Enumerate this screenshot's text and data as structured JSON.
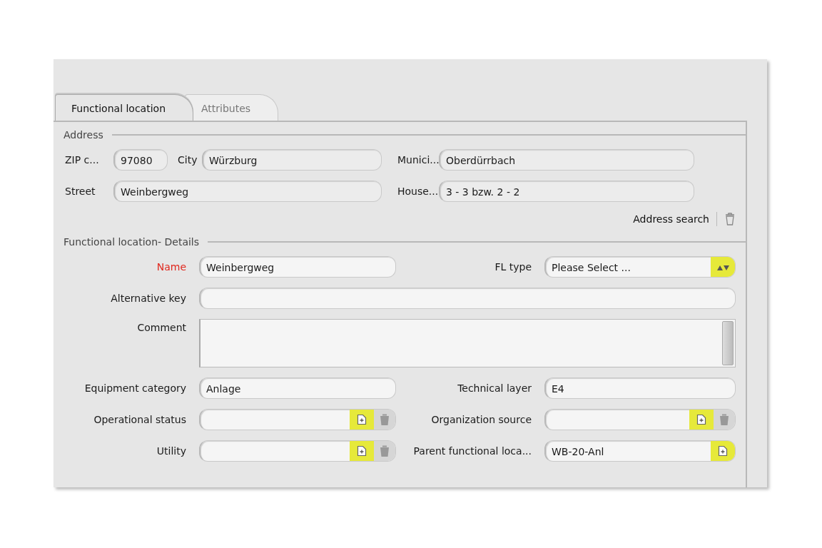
{
  "tabs": [
    {
      "label": "Functional location",
      "selected": true
    },
    {
      "label": "Attributes",
      "selected": false
    }
  ],
  "address": {
    "title": "Address",
    "fields": [
      {
        "label": "ZIP c...",
        "value": "97080"
      },
      {
        "label": "City",
        "value": "Würzburg"
      },
      {
        "label": "Munici...",
        "value": "Oberdürrbach"
      },
      {
        "label": "Street",
        "value": "Weinbergweg"
      },
      {
        "label": "House...",
        "value": "3 - 3 bzw. 2 - 2"
      }
    ],
    "search_label": "Address search"
  },
  "details": {
    "title": "Functional location- Details",
    "rows": [
      [
        {
          "kind": "text",
          "label": "Name",
          "required": true,
          "value": "Weinbergweg"
        },
        {
          "kind": "select",
          "label": "FL type",
          "required": false,
          "value": "Please Select ..."
        }
      ],
      [
        {
          "kind": "text",
          "label": "Alternative key",
          "required": false
        }
      ],
      [
        {
          "kind": "textarea",
          "label": "Comment",
          "required": false
        }
      ],
      [
        {
          "kind": "text",
          "label": "Equipment category",
          "required": false,
          "value": "Anlage"
        },
        {
          "kind": "text",
          "label": "Technical layer",
          "required": false,
          "value": "E4"
        }
      ],
      [
        {
          "kind": "lookup",
          "label": "Operational status",
          "required": false,
          "deletable": true
        },
        {
          "kind": "lookup",
          "label": "Organization source",
          "required": false,
          "deletable": true
        }
      ],
      [
        {
          "kind": "lookup",
          "label": "Utility",
          "required": false,
          "deletable": true
        },
        {
          "kind": "lookup",
          "label": "Parent functional loca...",
          "required": false,
          "deletable": false,
          "value": "WB-20-Anl"
        }
      ]
    ]
  }
}
